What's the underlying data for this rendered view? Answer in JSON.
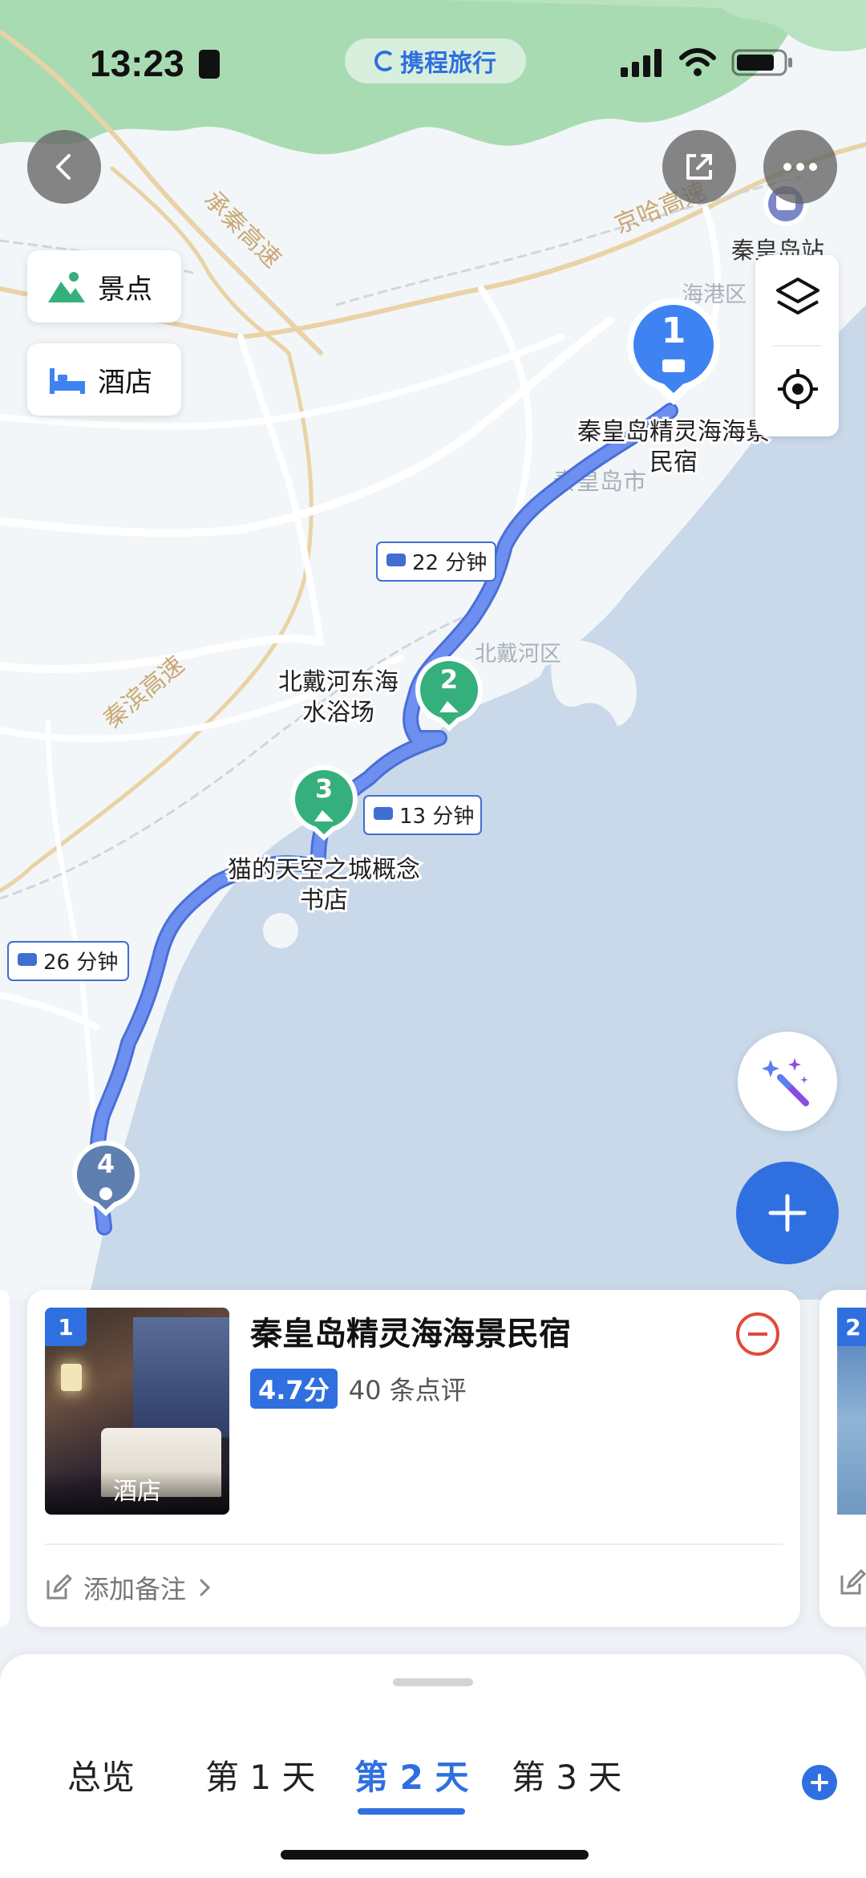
{
  "status_bar": {
    "time": "13:23",
    "app_badge": "携程旅行"
  },
  "map": {
    "road_labels": [
      "承秦高速",
      "京哈高速",
      "秦滨高速"
    ],
    "area_labels": [
      "海港区",
      "秦皇岛市",
      "北戴河区"
    ],
    "station_label": "秦皇岛站",
    "markers": [
      {
        "num": "1",
        "kind": "hotel",
        "label": "秦皇岛精灵海海景民宿"
      },
      {
        "num": "2",
        "kind": "scenic",
        "label": "北戴河东海水浴场"
      },
      {
        "num": "3",
        "kind": "scenic",
        "label": "猫的天空之城概念书店"
      },
      {
        "num": "4",
        "kind": "place",
        "label": ""
      }
    ],
    "durations": [
      "22 分钟",
      "13 分钟",
      "26 分钟"
    ]
  },
  "filters": {
    "scenic_label": "景点",
    "hotel_label": "酒店"
  },
  "card": {
    "index": "1",
    "title": "秦皇岛精灵海海景民宿",
    "score": "4.7分",
    "reviews": "40 条点评",
    "image_tag": "酒店",
    "note_label": "添加备注"
  },
  "next_card": {
    "index": "2"
  },
  "tabs": [
    {
      "label": "总览",
      "active": false
    },
    {
      "label": "第 1 天",
      "active": false
    },
    {
      "label": "第 2 天",
      "active": true
    },
    {
      "label": "第 3 天",
      "active": false
    }
  ],
  "colors": {
    "accent": "#2f6fe0",
    "route": "#5b84e8",
    "scenic_marker": "#35b07c",
    "sea": "#c9d9ea",
    "land": "#f3f6f8",
    "hills": "#a9dbb3"
  }
}
